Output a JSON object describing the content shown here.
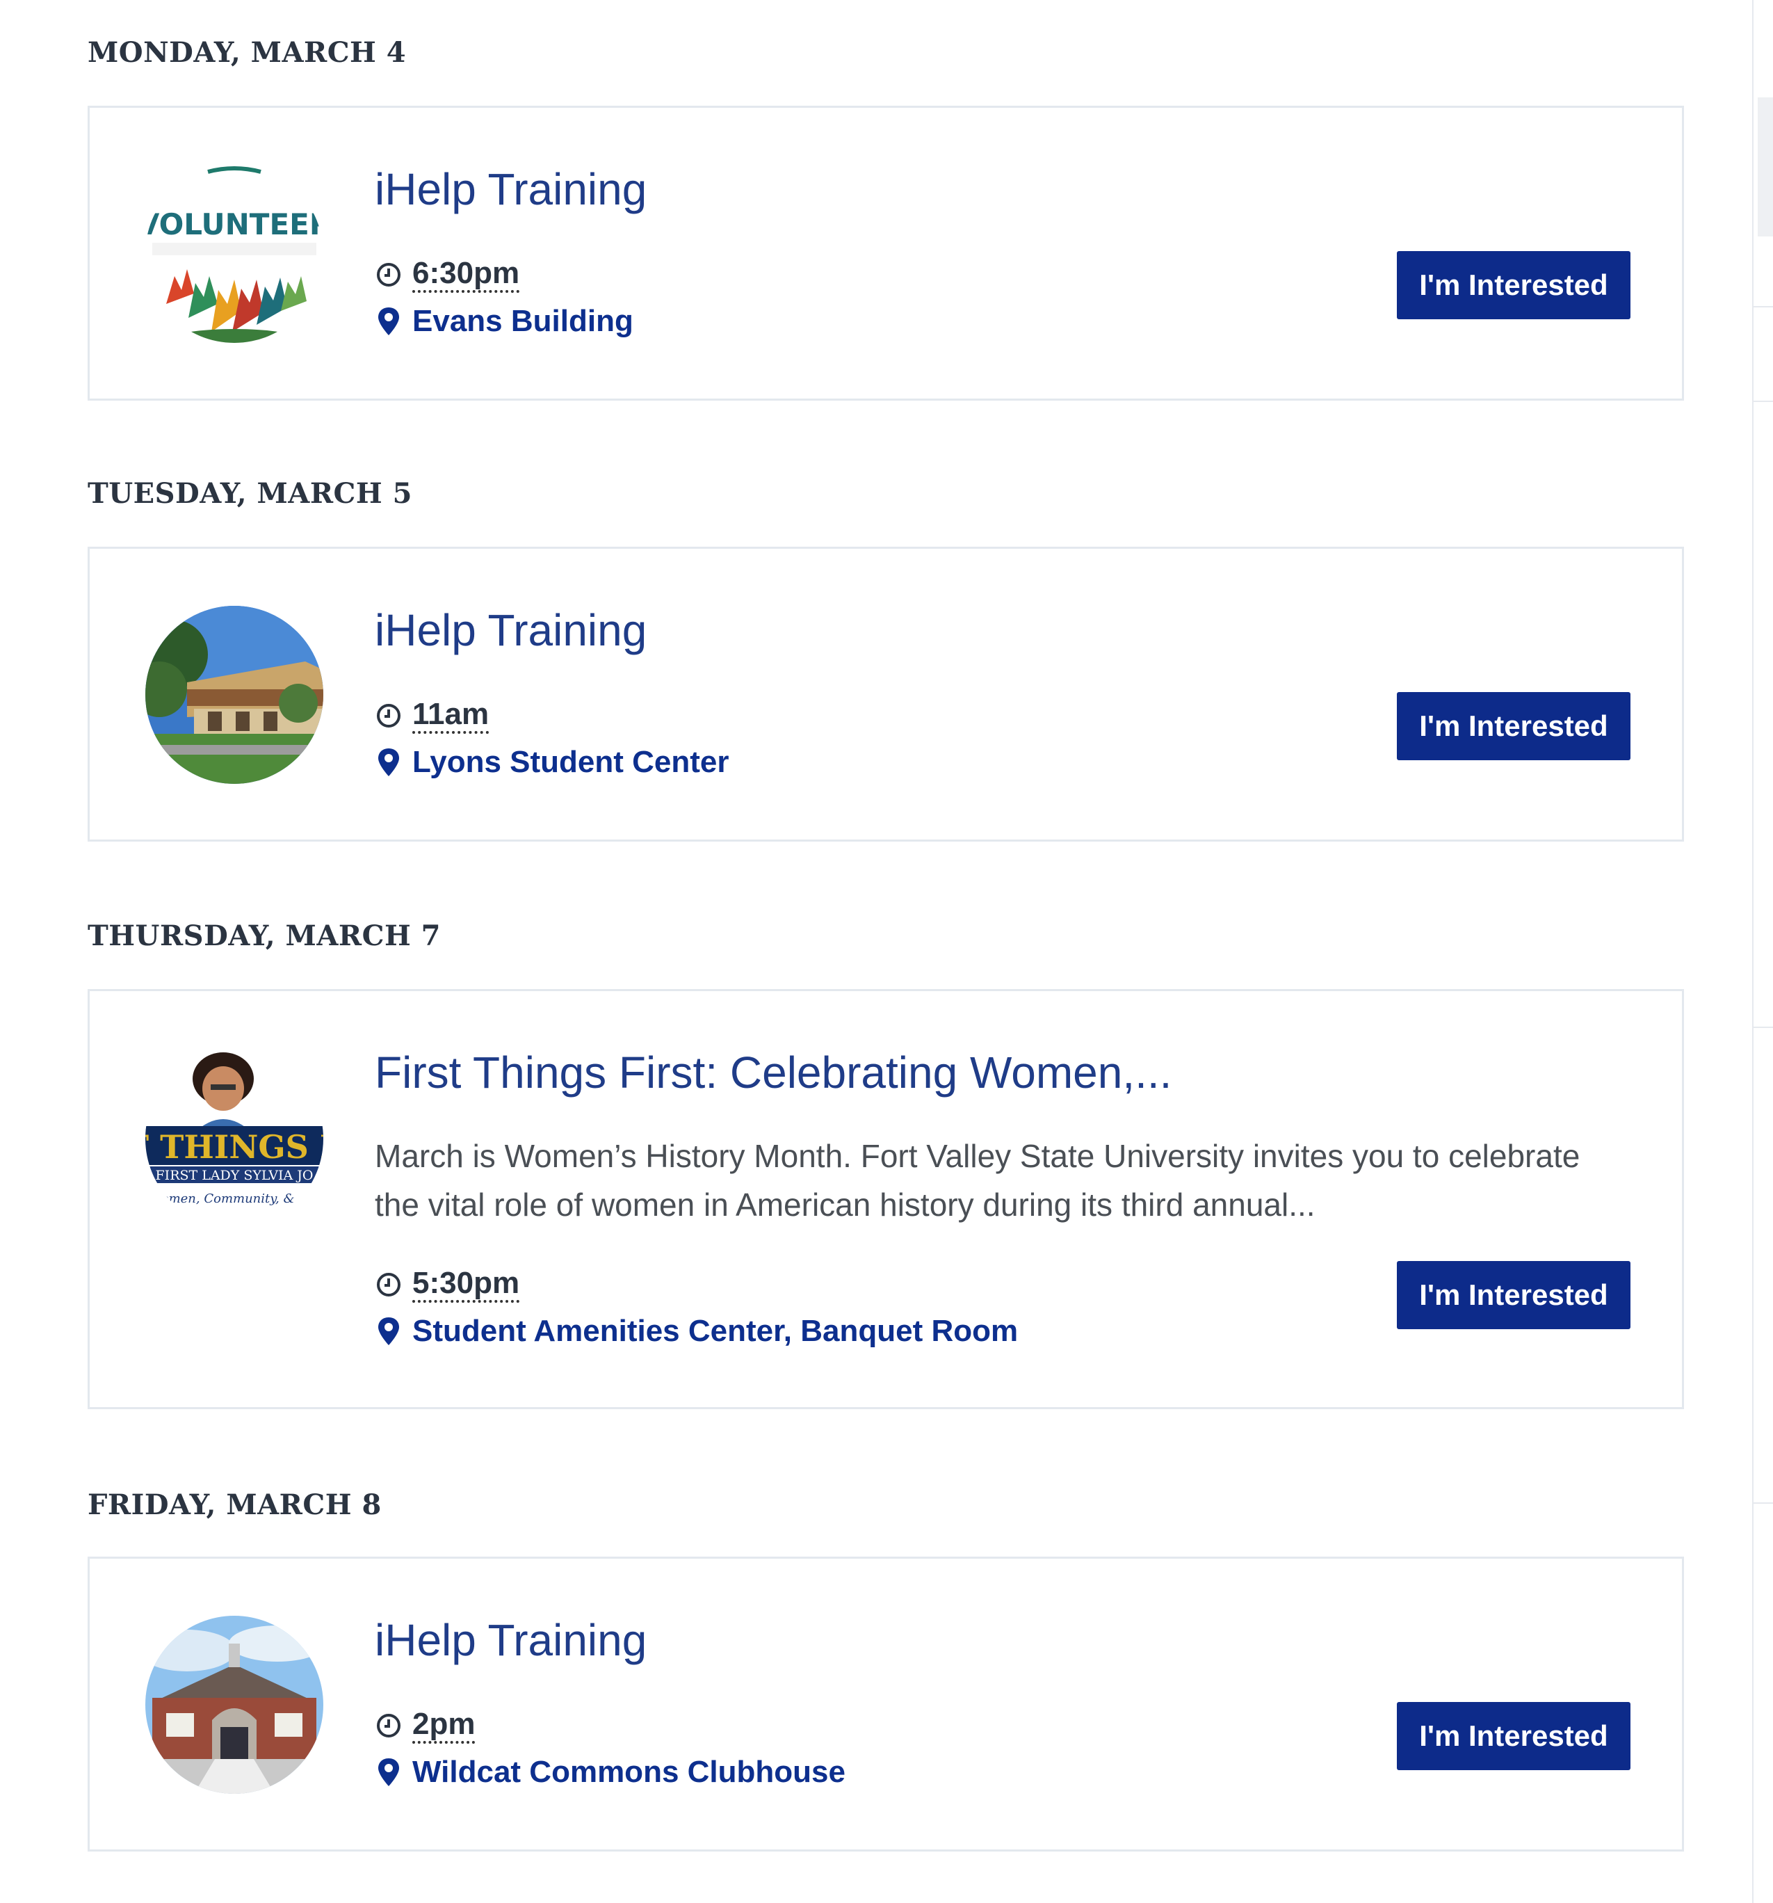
{
  "colors": {
    "title": "#1f3c88",
    "location": "#0d2f8e",
    "button_bg": "#0d2b8a",
    "heading": "#2b3441",
    "card_border": "#e3e8ee"
  },
  "days": [
    {
      "heading": "MONDAY, MARCH 4",
      "events": [
        {
          "title": "iHelp Training",
          "time": "6:30pm",
          "location": "Evans Building",
          "button": "I'm Interested",
          "thumb_text": "VOLUNTEER",
          "time_icon": "clock-icon",
          "location_icon": "map-pin-icon"
        }
      ]
    },
    {
      "heading": "TUESDAY, MARCH 5",
      "events": [
        {
          "title": "iHelp Training",
          "time": "11am",
          "location": "Lyons Student Center",
          "button": "I'm Interested",
          "time_icon": "clock-icon",
          "location_icon": "map-pin-icon"
        }
      ]
    },
    {
      "heading": "THURSDAY, MARCH 7",
      "events": [
        {
          "title": "First Things First: Celebrating Women,...",
          "description": "March is Women’s History Month. Fort Valley State University invites you to celebrate the vital role of women in American history during its third annual...",
          "time": "5:30pm",
          "location": "Student Amenities Center, Banquet Room",
          "button": "I'm Interested",
          "thumb_text": "FIRST THINGS FIRST",
          "thumb_subtext": "FIRST LADY SYLVIA JO",
          "thumb_script": "Women, Community, &",
          "time_icon": "clock-icon",
          "location_icon": "map-pin-icon"
        }
      ]
    },
    {
      "heading": "FRIDAY, MARCH 8",
      "events": [
        {
          "title": "iHelp Training",
          "time": "2pm",
          "location": "Wildcat Commons Clubhouse",
          "button": "I'm Interested",
          "time_icon": "clock-icon",
          "location_icon": "map-pin-icon"
        }
      ]
    }
  ]
}
